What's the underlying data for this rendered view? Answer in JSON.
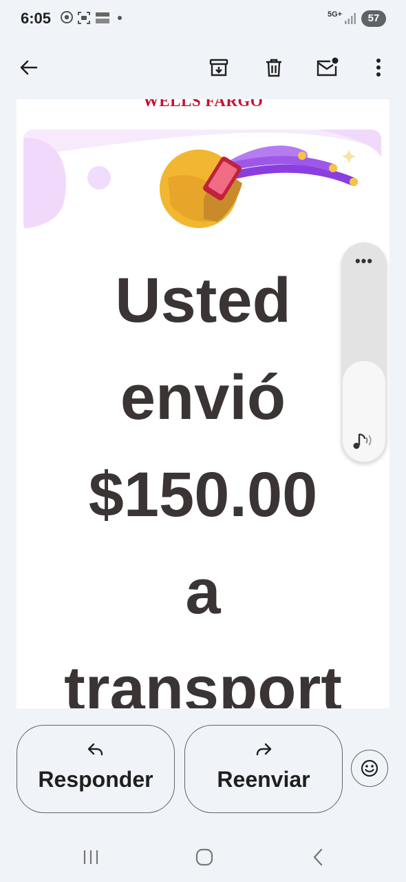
{
  "status_bar": {
    "time": "6:05",
    "network_label": "5G+",
    "battery_level": "57",
    "icons": [
      "chrome-icon",
      "screenshot-icon",
      "news-app-icon",
      "notification-dot",
      "signal-icon",
      "battery-icon"
    ]
  },
  "app_bar": {
    "icons": [
      "back-arrow-icon",
      "archive-icon",
      "delete-icon",
      "mark-unread-icon",
      "more-vert-icon"
    ]
  },
  "email": {
    "brand": "WELLS FARGO",
    "headline_lines": [
      "Usted",
      "envió",
      "$150.00",
      "a",
      "transport"
    ]
  },
  "scroll_widget": {
    "menu_glyph": "•••",
    "icons": [
      "more-horiz-icon",
      "read-aloud-icon"
    ]
  },
  "actions": {
    "reply_label": "Responder",
    "forward_label": "Reenviar",
    "icons": [
      "reply-icon",
      "forward-icon",
      "emoji-reaction-icon"
    ]
  },
  "nav_bar": {
    "icons": [
      "recents-icon",
      "home-icon",
      "back-icon"
    ]
  },
  "colors": {
    "background": "#f0f3f8",
    "brand_red": "#c8102e",
    "headline_text": "#3a3434"
  }
}
